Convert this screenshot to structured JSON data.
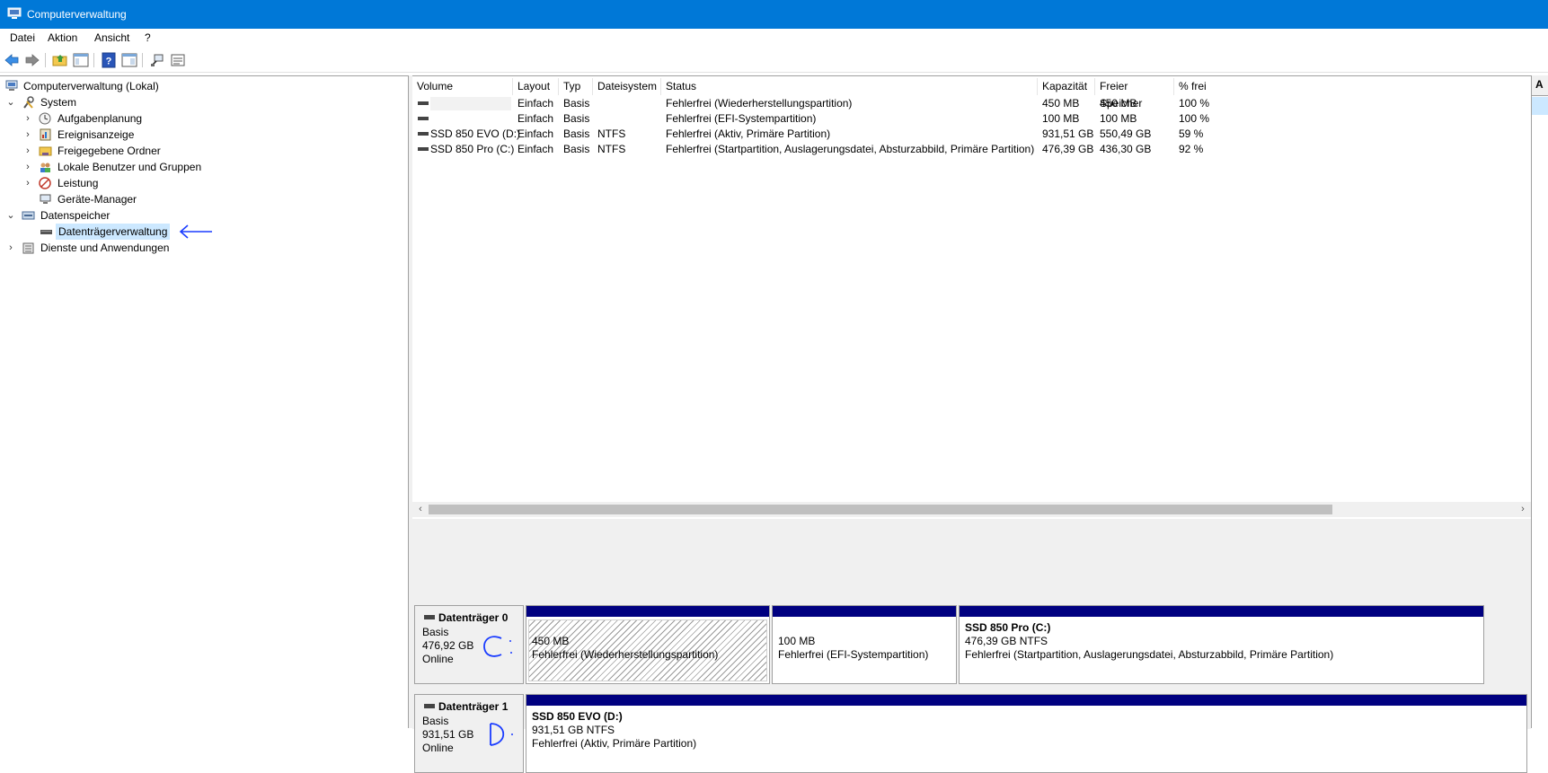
{
  "window": {
    "title": "Computerverwaltung",
    "app_icon": "computer-management-icon"
  },
  "menu": [
    "Datei",
    "Aktion",
    "Ansicht",
    "?"
  ],
  "toolbar": {
    "icons": [
      "back-arrow-icon",
      "forward-arrow-icon",
      "up-folder-icon",
      "show-hide-tree-icon",
      "help-icon",
      "show-hide-action-pane-icon",
      "connect-icon",
      "properties-icon"
    ]
  },
  "tree": {
    "root": "Computerverwaltung (Lokal)",
    "system": "System",
    "aufgabenplanung": "Aufgabenplanung",
    "ereignisanzeige": "Ereignisanzeige",
    "freigegebene": "Freigegebene Ordner",
    "lokale": "Lokale Benutzer und Gruppen",
    "leistung": "Leistung",
    "geraete": "Geräte-Manager",
    "datenspeicher": "Datenspeicher",
    "datentraeger": "Datenträgerverwaltung",
    "dienste": "Dienste und Anwendungen"
  },
  "volume_list": {
    "headers": [
      "Volume",
      "Layout",
      "Typ",
      "Dateisystem",
      "Status",
      "Kapazität",
      "Freier Speicher",
      "% frei"
    ],
    "rows": [
      {
        "volume": "",
        "layout": "Einfach",
        "typ": "Basis",
        "fs": "",
        "status": "Fehlerfrei (Wiederherstellungspartition)",
        "kap": "450 MB",
        "frei": "450 MB",
        "pct": "100 %"
      },
      {
        "volume": "",
        "layout": "Einfach",
        "typ": "Basis",
        "fs": "",
        "status": "Fehlerfrei (EFI-Systempartition)",
        "kap": "100 MB",
        "frei": "100 MB",
        "pct": "100 %"
      },
      {
        "volume": "SSD 850 EVO (D:)",
        "layout": "Einfach",
        "typ": "Basis",
        "fs": "NTFS",
        "status": "Fehlerfrei (Aktiv, Primäre Partition)",
        "kap": "931,51 GB",
        "frei": "550,49 GB",
        "pct": "59 %"
      },
      {
        "volume": "SSD 850 Pro (C:)",
        "layout": "Einfach",
        "typ": "Basis",
        "fs": "NTFS",
        "status": "Fehlerfrei (Startpartition, Auslagerungsdatei, Absturzabbild, Primäre Partition)",
        "kap": "476,39 GB",
        "frei": "436,30 GB",
        "pct": "92 %"
      }
    ]
  },
  "disks": [
    {
      "name": "Datenträger 0",
      "type": "Basis",
      "size": "476,92 GB",
      "state": "Online",
      "partitions": [
        {
          "title": "",
          "size": "450 MB",
          "status": "Fehlerfrei (Wiederherstellungspartition)"
        },
        {
          "title": "",
          "size": "100 MB",
          "status": "Fehlerfrei (EFI-Systempartition)"
        },
        {
          "title": "SSD 850 Pro  (C:)",
          "size": "476,39 GB NTFS",
          "status": "Fehlerfrei (Startpartition, Auslagerungsdatei, Absturzabbild, Primäre Partition)"
        }
      ]
    },
    {
      "name": "Datenträger 1",
      "type": "Basis",
      "size": "931,51 GB",
      "state": "Online",
      "partitions": [
        {
          "title": "SSD 850 EVO  (D:)",
          "size": "931,51 GB NTFS",
          "status": "Fehlerfrei (Aktiv, Primäre Partition)"
        }
      ]
    }
  ],
  "action_pane": {
    "header": "A"
  },
  "annotations": {
    "arrow": "arrow-annotation-icon",
    "disk0_letter": "C",
    "disk1_letter": "D",
    "color": "#1a3cff"
  }
}
